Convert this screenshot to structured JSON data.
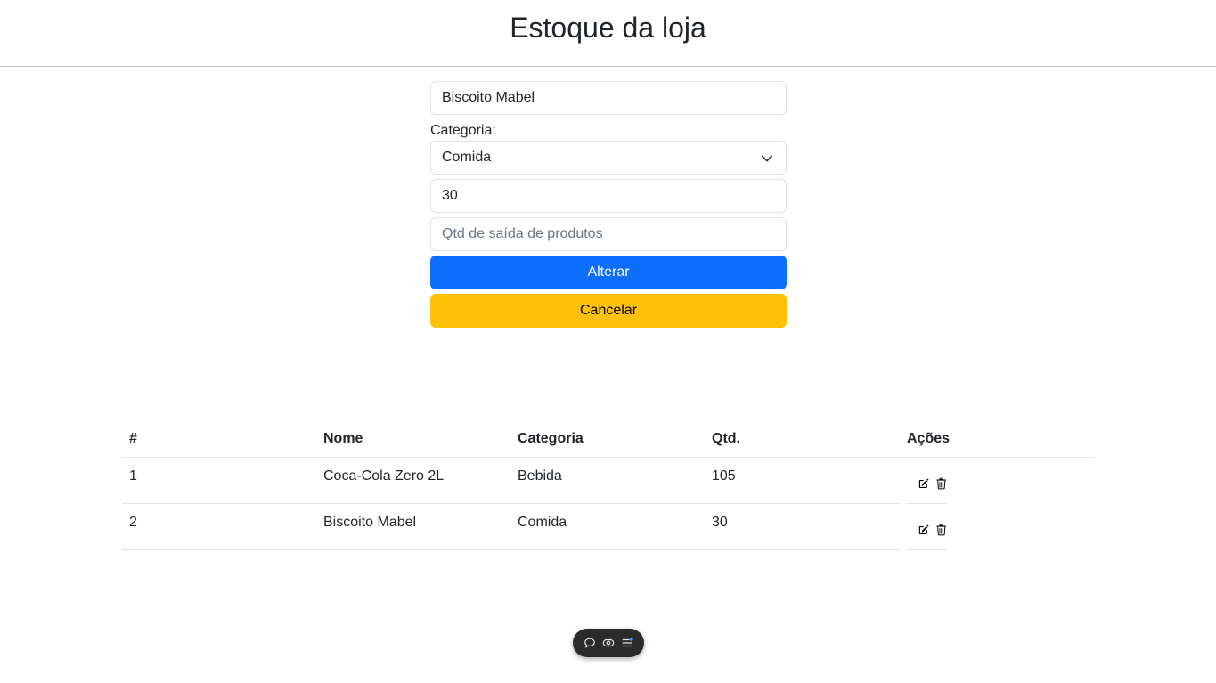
{
  "header": {
    "title": "Estoque da loja"
  },
  "form": {
    "name_value": "Biscoito Mabel",
    "category_label": "Categoria:",
    "category_value": "Comida",
    "quantity_value": "30",
    "exit_placeholder": "Qtd de saída de produtos",
    "submit_label": "Alterar",
    "cancel_label": "Cancelar"
  },
  "table": {
    "headers": [
      "#",
      "Nome",
      "Categoria",
      "Qtd.",
      "Ações"
    ],
    "rows": [
      {
        "id": "1",
        "name": "Coca-Cola Zero 2L",
        "category": "Bebida",
        "qty": "105"
      },
      {
        "id": "2",
        "name": "Biscoito Mabel",
        "category": "Comida",
        "qty": "30"
      }
    ]
  },
  "icons": {
    "edit": "edit-icon",
    "delete": "trash-icon",
    "toolbar": [
      "chat-icon",
      "eye-icon",
      "menu-icon"
    ]
  },
  "colors": {
    "primary": "#0d6efd",
    "warning": "#ffc107",
    "toolbar_bg": "#2b2b2b"
  }
}
